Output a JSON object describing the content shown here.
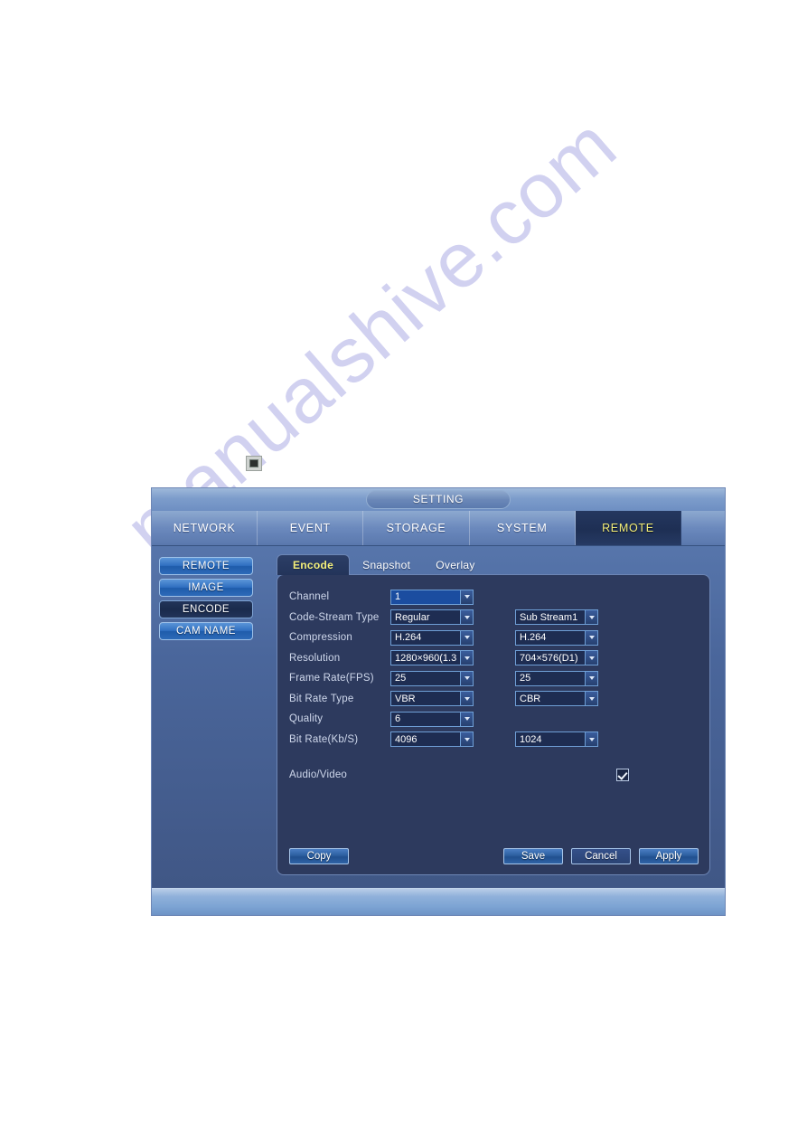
{
  "page": {
    "watermark": "manualshive.com"
  },
  "icons": {
    "marker": "square-marker-icon"
  },
  "window": {
    "title": "SETTING",
    "tabs": [
      {
        "label": "NETWORK",
        "active": false
      },
      {
        "label": "EVENT",
        "active": false
      },
      {
        "label": "STORAGE",
        "active": false
      },
      {
        "label": "SYSTEM",
        "active": false
      },
      {
        "label": "REMOTE",
        "active": true
      }
    ],
    "sidebar": {
      "items": [
        {
          "label": "REMOTE",
          "selected": false
        },
        {
          "label": "IMAGE",
          "selected": false
        },
        {
          "label": "ENCODE",
          "selected": true
        },
        {
          "label": "CAM NAME",
          "selected": false
        }
      ]
    },
    "subtabs": [
      {
        "label": "Encode",
        "active": true
      },
      {
        "label": "Snapshot",
        "active": false
      },
      {
        "label": "Overlay",
        "active": false
      }
    ],
    "form": {
      "rows": [
        {
          "label": "Channel",
          "main": "1",
          "sub": null
        },
        {
          "label": "Code-Stream Type",
          "main": "Regular",
          "sub": "Sub Stream1"
        },
        {
          "label": "Compression",
          "main": "H.264",
          "sub": "H.264"
        },
        {
          "label": "Resolution",
          "main": "1280×960(1.3",
          "sub": "704×576(D1)"
        },
        {
          "label": "Frame Rate(FPS)",
          "main": "25",
          "sub": "25"
        },
        {
          "label": "Bit Rate Type",
          "main": "VBR",
          "sub": "CBR"
        },
        {
          "label": "Quality",
          "main": "6",
          "sub": null
        },
        {
          "label": "Bit Rate(Kb/S)",
          "main": "4096",
          "sub": "1024"
        }
      ],
      "audio_video": {
        "label": "Audio/Video",
        "checked": true
      }
    },
    "buttons": {
      "copy": "Copy",
      "save": "Save",
      "cancel": "Cancel",
      "apply": "Apply"
    }
  },
  "colors": {
    "accent_active_tab_text": "#f5f07a",
    "panel_bg": "#2d3a5e",
    "window_bg": "#3f5583",
    "field_border": "#6f9fd6",
    "watermark": "#c9c9ee"
  }
}
